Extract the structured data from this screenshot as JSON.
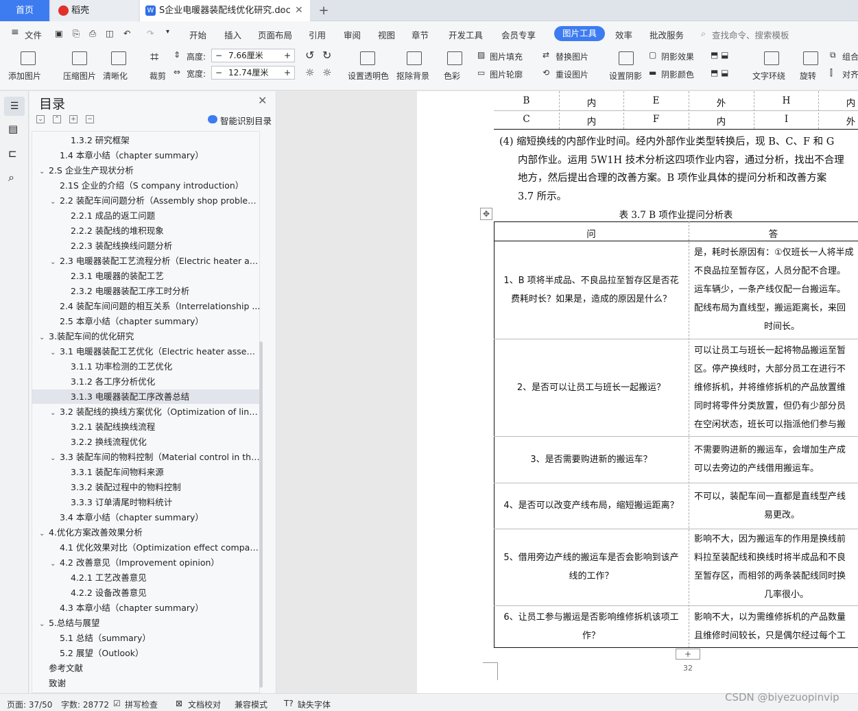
{
  "tabs": {
    "home": "首页",
    "daoke": "稻壳",
    "doc": "S企业电暖器装配线优化研究.doc"
  },
  "menu": {
    "file": "文件",
    "items": [
      "开始",
      "插入",
      "页面布局",
      "引用",
      "审阅",
      "视图",
      "章节",
      "开发工具",
      "会员专享"
    ],
    "active": "图片工具",
    "after": [
      "效率",
      "批改服务"
    ],
    "search": "查找命令、搜索模板"
  },
  "ribbon": {
    "add_pic": "添加图片",
    "compress": "压缩图片",
    "clarify": "清晰化",
    "crop": "裁剪",
    "height_label": "高度:",
    "height_value": "7.66厘米",
    "width_label": "宽度:",
    "width_value": "12.74厘米",
    "transparent": "设置透明色",
    "remove_bg": "抠除背景",
    "color": "色彩",
    "pic_fill": "图片填充",
    "pic_outline": "图片轮廓",
    "replace": "替换图片",
    "reset": "重设图片",
    "shadow_set": "设置阴影",
    "shadow_effect": "阴影效果",
    "shadow_color": "阴影颜色",
    "wrap": "文字环绕",
    "rotate": "旋转",
    "group": "组合",
    "align": "对齐"
  },
  "toc": {
    "title": "目录",
    "smart": "智能识别目录",
    "items": [
      {
        "text": "1.3.2 研究框架",
        "level": 3
      },
      {
        "text": "1.4 本章小结（chapter summary）",
        "level": 2
      },
      {
        "text": "2.S 企业生产现状分析",
        "level": 1,
        "caret": true
      },
      {
        "text": "2.1S 企业的介绍（S company introduction）",
        "level": 2
      },
      {
        "text": "2.2 装配车间问题分析（Assembly shop problem ...",
        "level": 2,
        "caret": true
      },
      {
        "text": "2.2.1 成品的返工问题",
        "level": 3
      },
      {
        "text": "2.2.2 装配线的堆积现象",
        "level": 3
      },
      {
        "text": "2.2.3 装配线换线问题分析",
        "level": 3
      },
      {
        "text": "2.3 电暖器装配工艺流程分析（Electric heater ass...",
        "level": 2,
        "caret": true
      },
      {
        "text": "2.3.1 电暖器的装配工艺",
        "level": 3
      },
      {
        "text": "2.3.2 电暖器装配工序工时分析",
        "level": 3
      },
      {
        "text": "2.4 装配车间问题的相互关系（Interrelationship ...",
        "level": 2
      },
      {
        "text": "2.5 本章小结（chapter summary）",
        "level": 2
      },
      {
        "text": "3.装配车间的优化研究",
        "level": 1,
        "caret": true
      },
      {
        "text": "3.1 电暖器装配工艺优化（Electric heater assemb...",
        "level": 2,
        "caret": true
      },
      {
        "text": "3.1.1 功率检测的工艺优化",
        "level": 3
      },
      {
        "text": "3.1.2 各工序分析优化",
        "level": 3
      },
      {
        "text": "3.1.3 电暖器装配工序改善总结",
        "level": 3,
        "selected": true
      },
      {
        "text": "3.2 装配线的换线方案优化（Optimization of line ...",
        "level": 2,
        "caret": true
      },
      {
        "text": "3.2.1 装配线换线流程",
        "level": 3
      },
      {
        "text": "3.2.2 换线流程优化",
        "level": 3
      },
      {
        "text": "3.3 装配车间的物料控制（Material control in the ...",
        "level": 2,
        "caret": true
      },
      {
        "text": "3.3.1 装配车间物料来源",
        "level": 3
      },
      {
        "text": "3.3.2 装配过程中的物料控制",
        "level": 3
      },
      {
        "text": "3.3.3 订单清尾时物料统计",
        "level": 3
      },
      {
        "text": "3.4 本章小结（chapter summary）",
        "level": 2
      },
      {
        "text": "4.优化方案改善效果分析",
        "level": 1,
        "caret": true
      },
      {
        "text": "4.1 优化效果对比（Optimization effect compari...",
        "level": 2
      },
      {
        "text": "4.2 改善意见（Improvement opinion）",
        "level": 2,
        "caret": true
      },
      {
        "text": "4.2.1 工艺改善意见",
        "level": 3
      },
      {
        "text": "4.2.2 设备改善意见",
        "level": 3
      },
      {
        "text": "4.3 本章小结（chapter summary）",
        "level": 2
      },
      {
        "text": "5.总结与展望",
        "level": 1,
        "caret": true
      },
      {
        "text": "5.1 总结（summary）",
        "level": 2
      },
      {
        "text": "5.2 展望（Outlook）",
        "level": 2
      },
      {
        "text": "参考文献",
        "level": 1
      },
      {
        "text": "致谢",
        "level": 1
      }
    ]
  },
  "doc": {
    "top_table": [
      [
        "B",
        "内",
        "E",
        "外",
        "H",
        "内"
      ],
      [
        "C",
        "内",
        "F",
        "内",
        "I",
        "外"
      ]
    ],
    "para_lines": [
      "(4) 缩短换线的内部作业时间。经内外部作业类型转换后，现 B、C、F 和 G",
      "内部作业。运用 5W1H 技术分析这四项作业内容，通过分析，找出不合理",
      "地方，然后提出合理的改善方案。B 项作业具体的提问分析和改善方案",
      "3.7 所示。"
    ],
    "table_caption": "表 3.7 B 项作业提问分析表",
    "col_q": "问",
    "col_a": "答",
    "rows": [
      {
        "q": [
          "1、B 项将半成品、不良品拉至暂存区是否花",
          "费耗时长？如果是，造成的原因是什么？"
        ],
        "a": [
          "是，耗时长原因有：①仅班长一人将半成",
          "不良品拉至暂存区，人员分配不合理。",
          "运车辆少，一条产线仅配一台搬运车。",
          "配线布局为直线型，搬运距离长，来回",
          "时间长。"
        ]
      },
      {
        "q": [
          "2、是否可以让员工与班长一起搬运？"
        ],
        "a": [
          "可以让员工与班长一起将物品搬运至暂",
          "区。停产换线时，大部分员工在进行不",
          "维修拆机，并将维修拆机的产品放置维",
          "同时将零件分类放置，但仍有少部分员",
          "在空闲状态，班长可以指派他们参与搬"
        ]
      },
      {
        "q": [
          "3、是否需要购进新的搬运车？"
        ],
        "a": [
          "不需要购进新的搬运车，会增加生产成",
          "可以去旁边的产线借用搬运车。"
        ]
      },
      {
        "q": [
          "4、是否可以改变产线布局，缩短搬运距离？"
        ],
        "a": [
          "不可以，装配车间一直都是直线型产线",
          "易更改。"
        ]
      },
      {
        "q": [
          "5、借用旁边产线的搬运车是否会影响到该产",
          "线的工作？"
        ],
        "a": [
          "影响不大，因为搬运车的作用是换线前",
          "料拉至装配线和换线时将半成品和不良",
          "至暂存区，而相邻的两条装配线同时换",
          "几率很小。"
        ]
      },
      {
        "q": [
          "6、让员工参与搬运是否影响维修拆机该项工",
          "作？"
        ],
        "a": [
          "影响不大，以为需维修拆机的产品数量",
          "且维修时间较长，只是偶尔经过每个工"
        ]
      }
    ],
    "page_num": "32"
  },
  "status": {
    "page": "页面: 37/50",
    "words": "字数: 28772",
    "spell": "拼写检查",
    "proof": "文档校对",
    "compat": "兼容模式",
    "font": "缺失字体"
  },
  "watermark": "CSDN @biyezuopinvip"
}
